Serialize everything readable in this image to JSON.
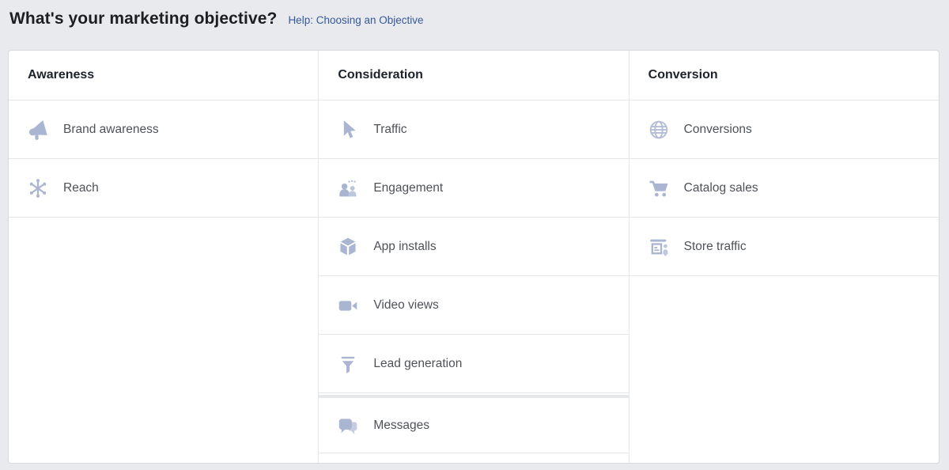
{
  "page": {
    "title": "What's your marketing objective?",
    "help_link": "Help: Choosing an Objective"
  },
  "colors": {
    "background": "#e9eaed",
    "panel_background": "#ffffff",
    "panel_border": "#d7d9dd",
    "divider": "#e5e6ea",
    "icon_accent": "#aab5d2",
    "icon_accent_light": "#c5cde0",
    "header_text": "#1d2129",
    "item_text": "#4e5257",
    "link": "#365899"
  },
  "columns": [
    {
      "header": "Awareness",
      "items": [
        {
          "label": "Brand awareness",
          "icon": "megaphone-icon"
        },
        {
          "label": "Reach",
          "icon": "reach-network-icon"
        }
      ]
    },
    {
      "header": "Consideration",
      "items": [
        {
          "label": "Traffic",
          "icon": "cursor-icon"
        },
        {
          "label": "Engagement",
          "icon": "people-engagement-icon"
        },
        {
          "label": "App installs",
          "icon": "cube-icon"
        },
        {
          "label": "Video views",
          "icon": "video-camera-icon"
        },
        {
          "label": "Lead generation",
          "icon": "funnel-icon"
        },
        {
          "label": "Messages",
          "icon": "chat-bubbles-icon",
          "separated": true
        }
      ]
    },
    {
      "header": "Conversion",
      "items": [
        {
          "label": "Conversions",
          "icon": "globe-icon"
        },
        {
          "label": "Catalog sales",
          "icon": "shopping-cart-icon"
        },
        {
          "label": "Store traffic",
          "icon": "storefront-icon"
        }
      ]
    }
  ]
}
